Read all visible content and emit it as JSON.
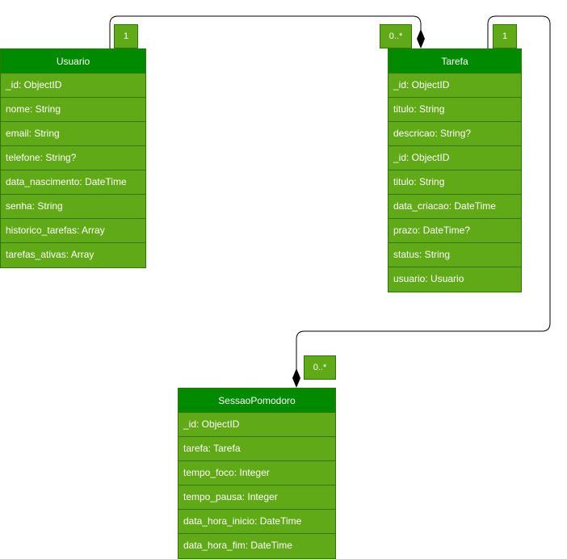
{
  "entities": {
    "usuario": {
      "name": "Usuario",
      "attributes": [
        "_id: ObjectID",
        "nome: String",
        "email: String",
        "telefone: String?",
        "data_nascimento: DateTime",
        "senha: String",
        "historico_tarefas: Array",
        "tarefas_ativas: Array"
      ]
    },
    "tarefa": {
      "name": "Tarefa",
      "attributes": [
        "_id: ObjectID",
        "titulo: String",
        "descricao: String?",
        "_id: ObjectID",
        "titulo: String",
        "data_criacao: DateTime",
        "prazo: DateTime?",
        "status: String",
        "usuario: Usuario"
      ]
    },
    "sessao": {
      "name": "SessaoPomodoro",
      "attributes": [
        "_id: ObjectID",
        "tarefa: Tarefa",
        "tempo_foco: Integer",
        "tempo_pausa: Integer",
        "data_hora_inicio: DateTime",
        "data_hora_fim: DateTime"
      ]
    }
  },
  "multiplicities": {
    "usuario_side": "1",
    "tarefa_side_from_usuario": "0..*",
    "tarefa_side_to_sessao": "1",
    "sessao_side": "0..*"
  },
  "colors": {
    "header": "#008a00",
    "body": "#60a917",
    "border": "#2d7600",
    "text": "#ffffff",
    "line": "#000000"
  }
}
